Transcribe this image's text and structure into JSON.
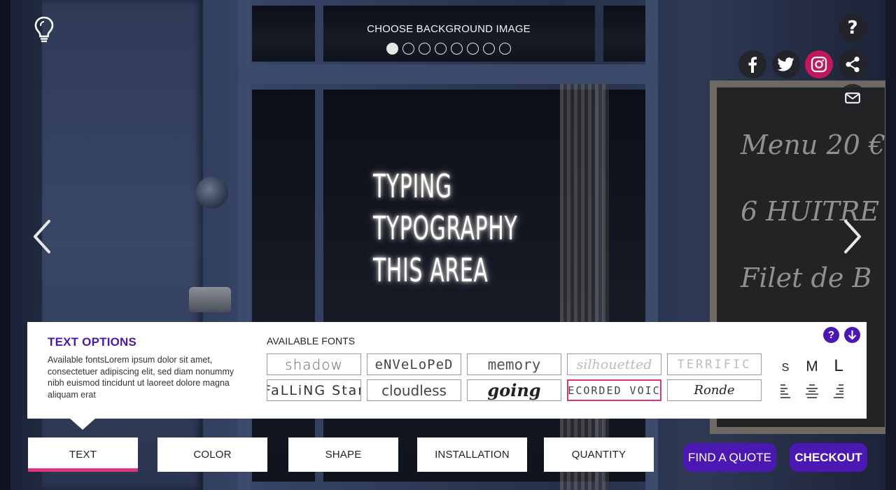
{
  "background_chooser": {
    "label": "CHOOSE BACKGROUND IMAGE",
    "dot_count": 8,
    "active_index": 0
  },
  "sign": {
    "lines": [
      "TYPING",
      "TYPOGRAPHY",
      "THIS AREA"
    ]
  },
  "chalkboard": {
    "lines": [
      "Menu 20 €",
      "6 HUITRE",
      "Filet de B"
    ]
  },
  "top_icons": {
    "help": "?",
    "social": [
      "facebook-icon",
      "twitter-icon",
      "instagram-icon",
      "share-icon"
    ],
    "mail": "mail-icon",
    "idea": "lightbulb-icon"
  },
  "text_options": {
    "title": "TEXT OPTIONS",
    "description": "Available fontsLorem ipsum dolor sit amet, consectetuer adipiscing elit, sed diam nonummy nibh euismod tincidunt ut laoreet dolore magna aliquam erat",
    "fonts_label": "AVAILABLE FONTS",
    "fonts": [
      {
        "label": "shadow"
      },
      {
        "label": "eNVeLoPeD"
      },
      {
        "label": "memory"
      },
      {
        "label": "silhouetted"
      },
      {
        "label": "TERRIFIC"
      },
      {
        "label": "FaLLiNG Star"
      },
      {
        "label": "cloudless"
      },
      {
        "label": "going"
      },
      {
        "label": "RECORDED VOICE"
      },
      {
        "label": "Ronde"
      }
    ],
    "selected_font": "RECORDED VOICE",
    "sizes": [
      "S",
      "M",
      "L"
    ],
    "alignments": [
      "align-left-icon",
      "align-center-icon",
      "align-right-icon"
    ],
    "panel_icons": {
      "help": "?",
      "download": "download-icon"
    }
  },
  "tabs": [
    {
      "label": "TEXT",
      "active": true
    },
    {
      "label": "COLOR",
      "active": false
    },
    {
      "label": "SHAPE",
      "active": false
    },
    {
      "label": "INSTALLATION",
      "active": false
    },
    {
      "label": "QUANTITY",
      "active": false
    }
  ],
  "actions": {
    "quote": "FIND A QUOTE",
    "checkout": "CHECKOUT"
  },
  "colors": {
    "accent_purple": "#4b18b3",
    "accent_pink": "#e0337d",
    "instagram": "#c2185b"
  }
}
